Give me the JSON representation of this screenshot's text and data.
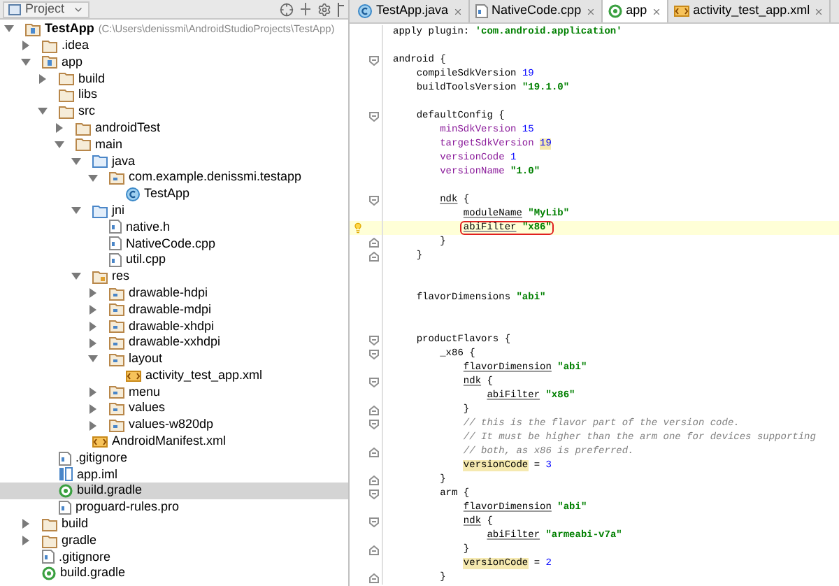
{
  "project_panel": {
    "title": "Project"
  },
  "tree": [
    {
      "label": "TestApp",
      "path": "(C:\\Users\\denissmi\\AndroidStudioProjects\\TestApp)",
      "kind": "module",
      "expanded": true,
      "selected": false,
      "children": [
        {
          "label": ".idea",
          "kind": "folder",
          "expanded": false,
          "selected": false
        },
        {
          "label": "app",
          "kind": "module",
          "expanded": true,
          "selected": false,
          "children": [
            {
              "label": "build",
              "kind": "folder",
              "expanded": false,
              "selected": false
            },
            {
              "label": "libs",
              "kind": "folder",
              "selected": false
            },
            {
              "label": "src",
              "kind": "folder",
              "expanded": true,
              "selected": false,
              "children": [
                {
                  "label": "androidTest",
                  "kind": "folder",
                  "expanded": false,
                  "selected": false
                },
                {
                  "label": "main",
                  "kind": "folder",
                  "expanded": true,
                  "selected": false,
                  "children": [
                    {
                      "label": "java",
                      "kind": "source",
                      "expanded": true,
                      "selected": false,
                      "children": [
                        {
                          "label": "com.example.denissmi.testapp",
                          "kind": "package",
                          "expanded": true,
                          "selected": false,
                          "children": [
                            {
                              "label": "TestApp",
                              "kind": "class",
                              "selected": false
                            }
                          ]
                        }
                      ]
                    },
                    {
                      "label": "jni",
                      "kind": "source",
                      "expanded": true,
                      "selected": false,
                      "children": [
                        {
                          "label": "native.h",
                          "kind": "file",
                          "selected": false
                        },
                        {
                          "label": "NativeCode.cpp",
                          "kind": "file",
                          "selected": false
                        },
                        {
                          "label": "util.cpp",
                          "kind": "file",
                          "selected": false
                        }
                      ]
                    },
                    {
                      "label": "res",
                      "kind": "resources",
                      "expanded": true,
                      "selected": false,
                      "children": [
                        {
                          "label": "drawable-hdpi",
                          "kind": "resdir",
                          "expanded": false,
                          "selected": false
                        },
                        {
                          "label": "drawable-mdpi",
                          "kind": "resdir",
                          "expanded": false,
                          "selected": false
                        },
                        {
                          "label": "drawable-xhdpi",
                          "kind": "resdir",
                          "expanded": false,
                          "selected": false
                        },
                        {
                          "label": "drawable-xxhdpi",
                          "kind": "resdir",
                          "expanded": false,
                          "selected": false
                        },
                        {
                          "label": "layout",
                          "kind": "resdir",
                          "expanded": true,
                          "selected": false,
                          "children": [
                            {
                              "label": "activity_test_app.xml",
                              "kind": "xml",
                              "selected": false
                            }
                          ]
                        },
                        {
                          "label": "menu",
                          "kind": "resdir",
                          "expanded": false,
                          "selected": false
                        },
                        {
                          "label": "values",
                          "kind": "resdir",
                          "expanded": false,
                          "selected": false
                        },
                        {
                          "label": "values-w820dp",
                          "kind": "resdir",
                          "expanded": false,
                          "selected": false
                        }
                      ]
                    },
                    {
                      "label": "AndroidManifest.xml",
                      "kind": "xml",
                      "selected": false
                    }
                  ]
                }
              ]
            },
            {
              "label": ".gitignore",
              "kind": "file",
              "selected": false
            },
            {
              "label": "app.iml",
              "kind": "iml",
              "selected": false
            },
            {
              "label": "build.gradle",
              "kind": "gradle",
              "selected": true
            },
            {
              "label": "proguard-rules.pro",
              "kind": "file",
              "selected": false
            }
          ]
        },
        {
          "label": "build",
          "kind": "folder",
          "expanded": false,
          "selected": false
        },
        {
          "label": "gradle",
          "kind": "folder",
          "expanded": false,
          "selected": false
        },
        {
          "label": ".gitignore",
          "kind": "file",
          "selected": false
        },
        {
          "label": "build.gradle",
          "kind": "gradle",
          "selected": false
        }
      ]
    }
  ],
  "tabs": [
    {
      "label": "TestApp.java",
      "kind": "class",
      "selected": false
    },
    {
      "label": "NativeCode.cpp",
      "kind": "file",
      "selected": false
    },
    {
      "label": "app",
      "kind": "gradle",
      "selected": true
    },
    {
      "label": "activity_test_app.xml",
      "kind": "xml",
      "selected": false
    }
  ],
  "code_lines": [
    {
      "kind": "plain",
      "current": false,
      "segments": [
        {
          "kind": "plain",
          "text": "apply plugin: "
        },
        {
          "kind": "str",
          "text": "'com.android.application'"
        }
      ]
    },
    {
      "kind": "plain",
      "current": false
    },
    {
      "kind": "foldstart",
      "current": false,
      "segments": [
        {
          "kind": "plain",
          "text": "android {"
        }
      ]
    },
    {
      "kind": "plain",
      "current": false,
      "segments": [
        {
          "kind": "plain",
          "text": "    compileSdkVersion "
        },
        {
          "kind": "num",
          "text": "19"
        }
      ]
    },
    {
      "kind": "plain",
      "current": false,
      "segments": [
        {
          "kind": "plain",
          "text": "    buildToolsVersion "
        },
        {
          "kind": "str",
          "text": "\"19.1.0\""
        }
      ]
    },
    {
      "kind": "plain",
      "current": false
    },
    {
      "kind": "foldstart",
      "current": false,
      "segments": [
        {
          "kind": "plain",
          "text": "    defaultConfig {"
        }
      ]
    },
    {
      "kind": "plain",
      "current": false,
      "segments": [
        {
          "kind": "prop",
          "text": "        minSdkVersion "
        },
        {
          "kind": "num",
          "text": "15"
        }
      ]
    },
    {
      "kind": "plain",
      "current": false,
      "segments": [
        {
          "kind": "prop",
          "text": "        targetSdkVersion "
        },
        {
          "kind": "flagnum",
          "text": "19"
        }
      ]
    },
    {
      "kind": "plain",
      "current": false,
      "segments": [
        {
          "kind": "prop",
          "text": "        versionCode "
        },
        {
          "kind": "num",
          "text": "1"
        }
      ]
    },
    {
      "kind": "plain",
      "current": false,
      "segments": [
        {
          "kind": "prop",
          "text": "        versionName "
        },
        {
          "kind": "str",
          "text": "\"1.0\""
        }
      ]
    },
    {
      "kind": "plain",
      "current": false
    },
    {
      "kind": "foldstart",
      "current": false,
      "segments": [
        {
          "kind": "ref",
          "text": "        ndk"
        },
        {
          "kind": "plain",
          "text": " {"
        }
      ]
    },
    {
      "kind": "plain",
      "current": false,
      "segments": [
        {
          "kind": "ref",
          "text": "            moduleName "
        },
        {
          "kind": "str",
          "text": "\"MyLib\""
        }
      ]
    },
    {
      "kind": "plain",
      "current": true,
      "segments": [
        {
          "kind": "ref",
          "text": "            abiFilter "
        },
        {
          "kind": "str",
          "text": "\"x86\""
        }
      ]
    },
    {
      "kind": "foldend",
      "current": false,
      "segments": [
        {
          "kind": "plain",
          "text": "        }"
        }
      ]
    },
    {
      "kind": "foldend",
      "current": false,
      "segments": [
        {
          "kind": "plain",
          "text": "    }"
        }
      ]
    },
    {
      "kind": "plain",
      "current": false
    },
    {
      "kind": "plain",
      "current": false
    },
    {
      "kind": "plain",
      "current": false,
      "segments": [
        {
          "kind": "plain",
          "text": "    flavorDimensions "
        },
        {
          "kind": "str",
          "text": "\"abi\""
        }
      ]
    },
    {
      "kind": "plain",
      "current": false
    },
    {
      "kind": "plain",
      "current": false
    },
    {
      "kind": "foldstart",
      "current": false,
      "segments": [
        {
          "kind": "plain",
          "text": "    productFlavors {"
        }
      ]
    },
    {
      "kind": "foldstart",
      "current": false,
      "segments": [
        {
          "kind": "plain",
          "text": "        _x86 {"
        }
      ]
    },
    {
      "kind": "plain",
      "current": false,
      "segments": [
        {
          "kind": "ref",
          "text": "            flavorDimension "
        },
        {
          "kind": "str",
          "text": "\"abi\""
        }
      ]
    },
    {
      "kind": "foldstart",
      "current": false,
      "segments": [
        {
          "kind": "ref",
          "text": "            ndk"
        },
        {
          "kind": "plain",
          "text": " {"
        }
      ]
    },
    {
      "kind": "plain",
      "current": false,
      "segments": [
        {
          "kind": "ref",
          "text": "                abiFilter "
        },
        {
          "kind": "str",
          "text": "\"x86\""
        }
      ]
    },
    {
      "kind": "foldend",
      "current": false,
      "segments": [
        {
          "kind": "plain",
          "text": "            }"
        }
      ]
    },
    {
      "kind": "foldstart",
      "current": false,
      "segments": [
        {
          "kind": "comment",
          "text": "            // this is the flavor part of the version code."
        }
      ]
    },
    {
      "kind": "plain",
      "current": false,
      "segments": [
        {
          "kind": "comment",
          "text": "            // It must be higher than the arm one for devices supporting"
        }
      ]
    },
    {
      "kind": "foldend",
      "current": false,
      "segments": [
        {
          "kind": "comment",
          "text": "            // both, as x86 is preferred."
        }
      ]
    },
    {
      "kind": "plain",
      "current": false,
      "segments": [
        {
          "kind": "flag",
          "text": "            versionCode"
        },
        {
          "kind": "plain",
          "text": " = "
        },
        {
          "kind": "num",
          "text": "3"
        }
      ]
    },
    {
      "kind": "foldend",
      "current": false,
      "segments": [
        {
          "kind": "plain",
          "text": "        }"
        }
      ]
    },
    {
      "kind": "foldstart",
      "current": false,
      "segments": [
        {
          "kind": "plain",
          "text": "        arm {"
        }
      ]
    },
    {
      "kind": "plain",
      "current": false,
      "segments": [
        {
          "kind": "ref",
          "text": "            flavorDimension "
        },
        {
          "kind": "str",
          "text": "\"abi\""
        }
      ]
    },
    {
      "kind": "foldstart",
      "current": false,
      "segments": [
        {
          "kind": "ref",
          "text": "            ndk"
        },
        {
          "kind": "plain",
          "text": " {"
        }
      ]
    },
    {
      "kind": "plain",
      "current": false,
      "segments": [
        {
          "kind": "ref",
          "text": "                abiFilter "
        },
        {
          "kind": "str",
          "text": "\"armeabi-v7a\""
        }
      ]
    },
    {
      "kind": "foldend",
      "current": false,
      "segments": [
        {
          "kind": "plain",
          "text": "            }"
        }
      ]
    },
    {
      "kind": "plain",
      "current": false,
      "segments": [
        {
          "kind": "flag",
          "text": "            versionCode"
        },
        {
          "kind": "plain",
          "text": " = "
        },
        {
          "kind": "num",
          "text": "2"
        }
      ]
    },
    {
      "kind": "foldend",
      "current": false,
      "segments": [
        {
          "kind": "plain",
          "text": "        }"
        }
      ]
    }
  ]
}
